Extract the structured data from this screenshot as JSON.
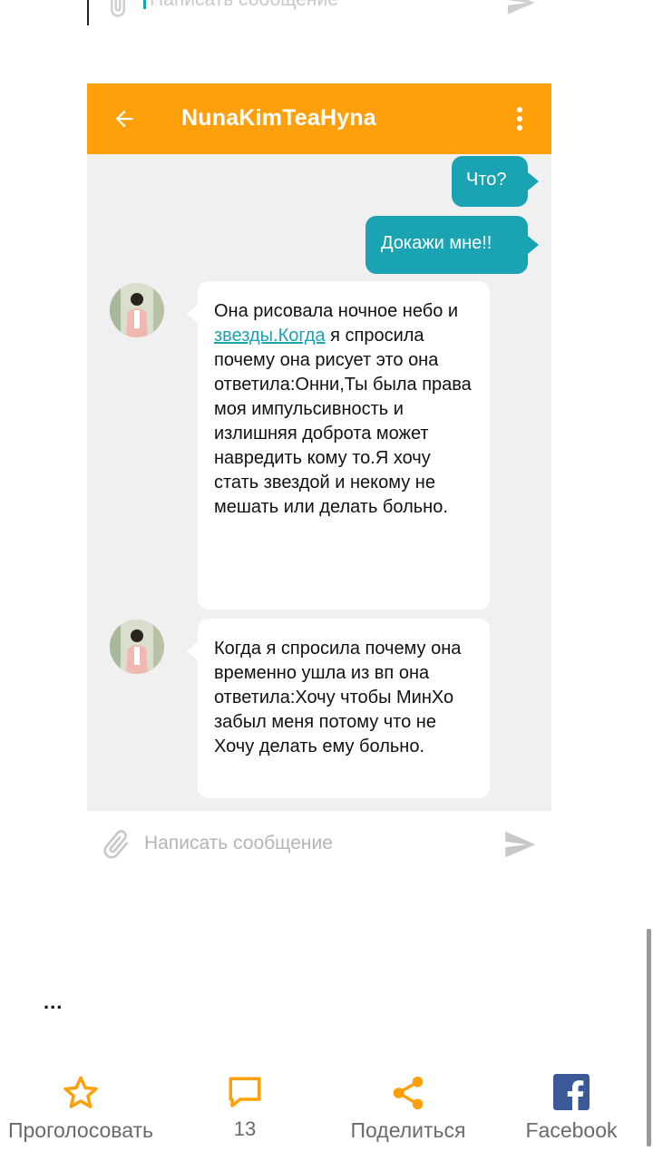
{
  "previous_compose": {
    "placeholder": "Написать сообщение"
  },
  "chat": {
    "contact_name": "NunaKimTeaHyna",
    "messages": [
      {
        "direction": "outgoing",
        "text": "Что?"
      },
      {
        "direction": "outgoing",
        "text": "Докажи мне!!"
      },
      {
        "direction": "incoming",
        "text_before_link": "Она рисовала ночное небо и ",
        "link_text": "звезды.Когда",
        "text_after_link": " я спросила почему она рисует это она ответила:Онни,Ты была права моя импульсивность и излишняя доброта может навредить кому то.Я хочу стать звездой и некому не мешать или делать больно."
      },
      {
        "direction": "incoming",
        "text": "Когда я спросила почему она временно ушла из вп она ответила:Хочу чтобы МинХо забыл меня потому что не Хочу делать ему больно."
      }
    ],
    "compose": {
      "placeholder": "Написать сообщение"
    }
  },
  "post": {
    "ellipsis": "..."
  },
  "actions": {
    "vote_label": "Проголосовать",
    "comments_count": "13",
    "share_label": "Поделиться",
    "facebook_label": "Facebook"
  },
  "colors": {
    "header": "#ff9f0a",
    "outgoing_bubble": "#1aa3b3",
    "incoming_bubble": "#ffffff",
    "chat_background": "#f0f0f0",
    "action_icon": "#ff9f0a",
    "facebook": "#3b5998"
  },
  "icons": {
    "back": "arrow-left-icon",
    "menu": "more-vertical-icon",
    "attach": "paperclip-icon",
    "send": "send-icon",
    "vote": "star-icon",
    "comments": "speech-bubble-icon",
    "share": "share-icon",
    "facebook": "facebook-icon"
  }
}
